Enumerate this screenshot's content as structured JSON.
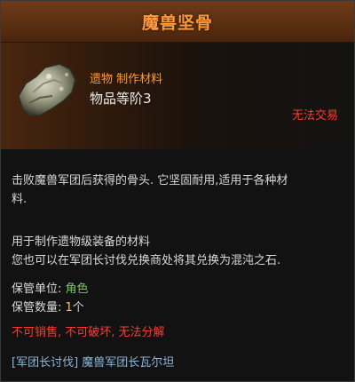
{
  "title": "魔兽坚骨",
  "header": {
    "item_type": "遗物 制作材料",
    "item_grade": "物品等阶3",
    "icon_name": "bone-material-icon"
  },
  "trade_status": "无法交易",
  "description": {
    "line1": "击败魔兽军团后获得的骨头. 它坚固耐用,适用于各种材",
    "line2": "料."
  },
  "usage": {
    "line1": "用于制作遗物级装备的材料",
    "line2": "您也可以在军团长讨伐兑换商处将其兑换为混沌之石."
  },
  "storage": {
    "unit_label": "保管单位: ",
    "unit_value": "角色",
    "count_label": "保管数量: ",
    "count_value": "1",
    "count_suffix": "个"
  },
  "restrictions": "不可销售, 不可破坏, 无法分解",
  "source": "[军团长讨伐] 魔兽军团长瓦尔坦",
  "colors": {
    "title": "#ff9a3a",
    "type": "#ff9a3a",
    "restriction": "#ff3b2f",
    "storage_value": "#7cc36a",
    "storage_count": "#f2c45a",
    "source": "#8ab6d9"
  }
}
